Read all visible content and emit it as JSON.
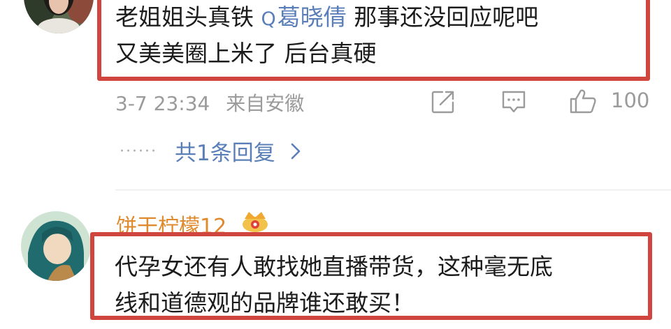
{
  "comment1": {
    "line1_prefix": "老姐姐头真铁",
    "mention": "葛晓倩",
    "line1_suffix": "那事还没回应呢吧",
    "line2": "又美美圈上米了 后台真硬",
    "timestamp": "3-7 23:34",
    "source": "来自安徽",
    "like_count": "100",
    "replies_label": "共1条回复"
  },
  "comment2": {
    "username": "饼干柠檬12",
    "line1": "代孕女还有人敢找她直播带货，这种毫无底",
    "line2": "线和道德观的品牌谁还敢买！"
  },
  "colors": {
    "highlight_border": "#d0463e",
    "link_blue": "#5a7fb8",
    "username_orange": "#e08a2e",
    "meta_gray": "#9b9b9b"
  },
  "icons": {
    "share": "share-icon",
    "reply": "comment-icon",
    "like": "thumbs-up-icon",
    "mention": "search-icon",
    "badge": "crown-badge-icon",
    "chevron": "chevron-right-icon"
  }
}
